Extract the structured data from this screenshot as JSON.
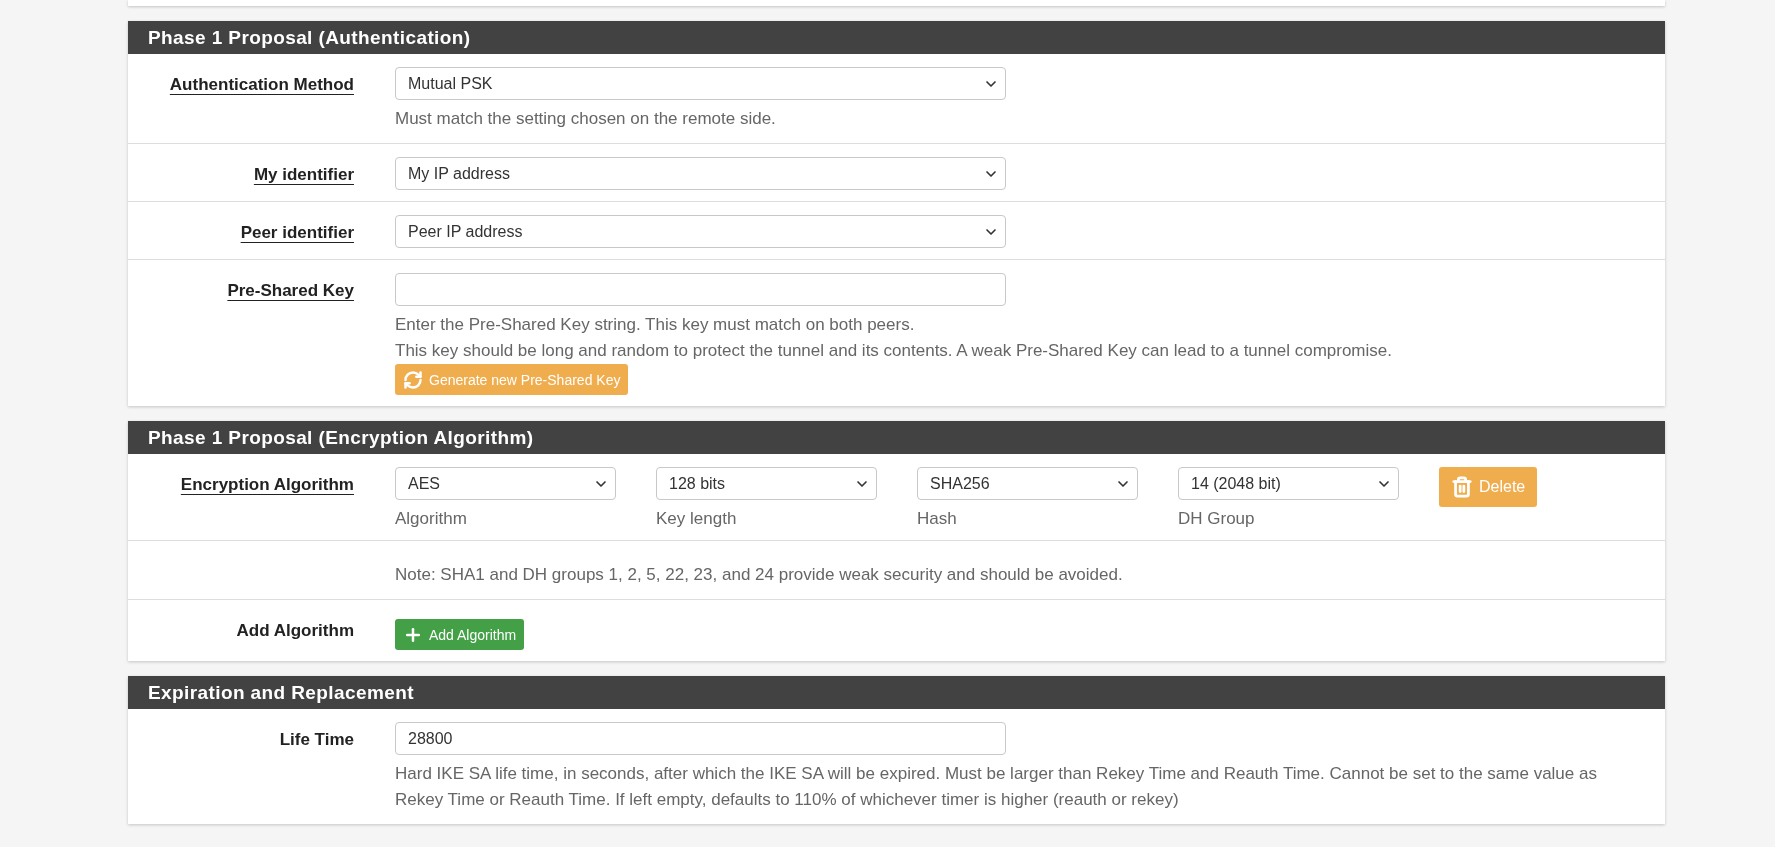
{
  "sections": [
    {
      "title": "Phase 1 Proposal (Authentication)",
      "rows": [
        {
          "kind": "select",
          "label": "Authentication Method",
          "label_link": true,
          "value": "Mutual PSK",
          "help": [
            "Must match the setting chosen on the remote side."
          ]
        },
        {
          "kind": "select",
          "label": "My identifier",
          "label_link": true,
          "value": "My IP address"
        },
        {
          "kind": "select",
          "label": "Peer identifier",
          "label_link": true,
          "value": "Peer IP address"
        },
        {
          "kind": "input",
          "label": "Pre-Shared Key",
          "label_link": true,
          "help": [
            "Enter the Pre-Shared Key string. This key must match on both peers.",
            "This key should be long and random to protect the tunnel and its contents. A weak Pre-Shared Key can lead to a tunnel compromise."
          ],
          "button": {
            "kind": "generate",
            "label": "Generate new Pre-Shared Key"
          }
        }
      ]
    },
    {
      "title": "Phase 1 Proposal (Encryption Algorithm)",
      "rows": [
        {
          "kind": "algorithm",
          "label": "Encryption Algorithm",
          "label_link": true,
          "selects": [
            {
              "value": "AES",
              "caption": "Algorithm"
            },
            {
              "value": "128 bits",
              "caption": "Key length"
            },
            {
              "value": "SHA256",
              "caption": "Hash"
            },
            {
              "value": "14 (2048 bit)",
              "caption": "DH Group"
            }
          ],
          "button": {
            "kind": "delete",
            "label": "Delete"
          }
        },
        {
          "kind": "note",
          "help": [
            "Note: SHA1 and DH groups 1, 2, 5, 22, 23, and 24 provide weak security and should be avoided."
          ]
        },
        {
          "kind": "button",
          "label": "Add Algorithm",
          "label_link": false,
          "button": {
            "kind": "add",
            "label": "Add Algorithm"
          }
        }
      ]
    },
    {
      "title": "Expiration and Replacement",
      "rows": [
        {
          "kind": "input",
          "label": "Life Time",
          "label_link": false,
          "value": "28800",
          "help": [
            "Hard IKE SA life time, in seconds, after which the IKE SA will be expired. Must be larger than Rekey Time and Reauth Time. Cannot be set to the same value as Rekey Time or Reauth Time. If left empty, defaults to 110% of whichever timer is higher (reauth or rekey)"
          ]
        }
      ]
    }
  ]
}
